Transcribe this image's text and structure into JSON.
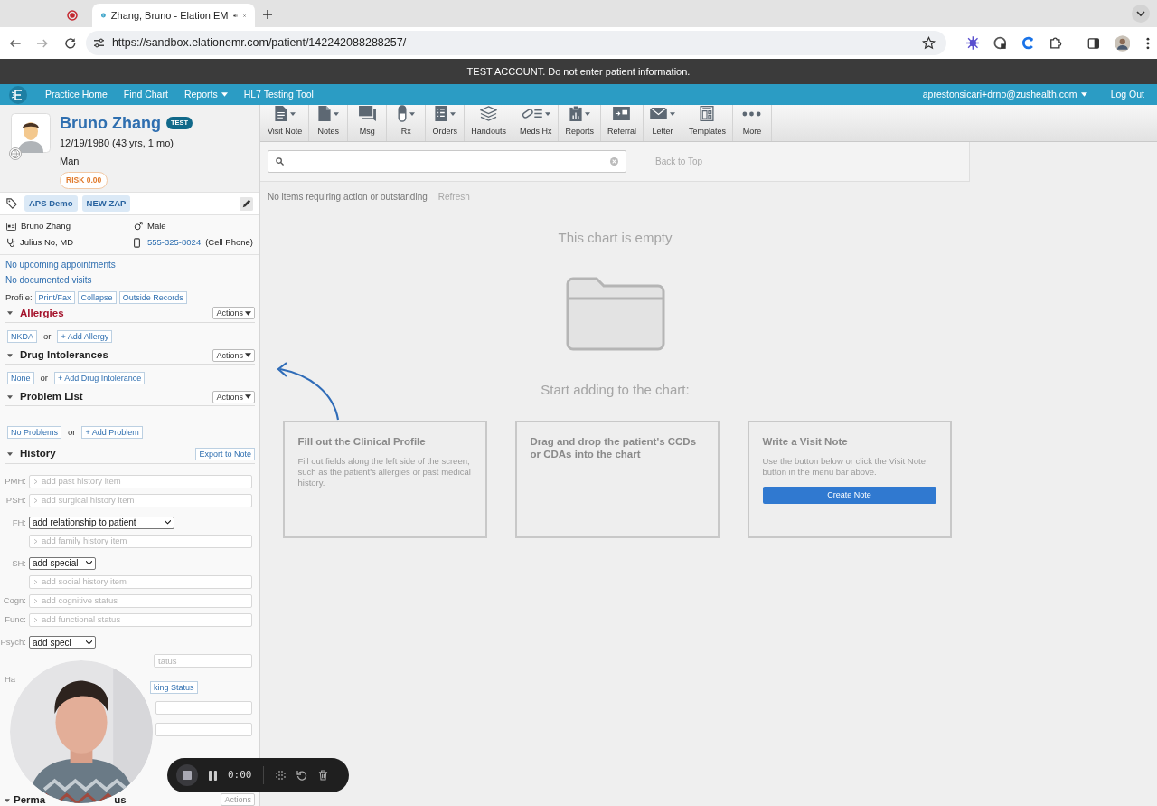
{
  "browser": {
    "tabs": [
      {
        "kind": "recording",
        "selected": false
      },
      {
        "kind": "page",
        "title": "Zhang, Bruno - Elation EM",
        "selected": true
      }
    ],
    "url": "https://sandbox.elationemr.com/patient/142242088288257/"
  },
  "banner": "TEST ACCOUNT. Do not enter patient information.",
  "nav": {
    "links": [
      {
        "label": "Practice Home",
        "dropdown": false
      },
      {
        "label": "Find Chart",
        "dropdown": false
      },
      {
        "label": "Reports",
        "dropdown": true
      },
      {
        "label": "HL7 Testing Tool",
        "dropdown": false
      }
    ],
    "user": "aprestonsicari+drno@zushealth.com",
    "logout": "Log Out"
  },
  "patient": {
    "name": "Bruno Zhang",
    "badge": "TEST",
    "dob": "12/19/1980 (43 yrs, 1 mo)",
    "gender": "Man",
    "risk": "RISK 0.00",
    "tags": [
      "APS Demo",
      "NEW ZAP"
    ],
    "details": [
      {
        "kind": "name",
        "text": "Bruno Zhang"
      },
      {
        "kind": "sex",
        "text": "Male"
      },
      {
        "kind": "provider",
        "text": "Julius No, MD"
      },
      {
        "kind": "phone",
        "link": "555-325-8024",
        "text": "(Cell Phone)"
      }
    ],
    "links": [
      "No upcoming appointments",
      "No documented visits"
    ],
    "profile": {
      "label": "Profile:",
      "buttons": [
        "Print/Fax",
        "Collapse",
        "Outside Records"
      ]
    }
  },
  "sections": [
    {
      "title": "Allergies",
      "alert": true,
      "action": "Actions",
      "options": [
        "NKDA",
        "+ Add Allergy"
      ],
      "joiner": "or"
    },
    {
      "title": "Drug Intolerances",
      "alert": false,
      "action": "Actions",
      "options": [
        "None",
        "+ Add Drug Intolerance"
      ],
      "joiner": "or"
    },
    {
      "title": "Problem List",
      "alert": false,
      "action": "Actions",
      "options": [
        "No Problems",
        "+ Add Problem"
      ],
      "joiner": "or"
    }
  ],
  "history": {
    "title": "History",
    "action": "Export to Note",
    "rows": [
      {
        "kind": "input",
        "label": "PMH:",
        "placeholder": "add past history item"
      },
      {
        "kind": "input",
        "label": "PSH:",
        "placeholder": "add surgical history item"
      },
      {
        "kind": "select",
        "label": "FH:",
        "value": "add relationship to patient"
      },
      {
        "kind": "input",
        "placeholder": "add family history item"
      },
      {
        "kind": "select",
        "label": "SH:",
        "value": "add special"
      },
      {
        "kind": "input",
        "placeholder": "add social history item"
      },
      {
        "kind": "input",
        "label": "Cogn:",
        "placeholder": "add cognitive status"
      },
      {
        "kind": "input",
        "label": "Func:",
        "placeholder": "add functional status"
      },
      {
        "kind": "select",
        "label": "Psych:",
        "value": "add speci"
      },
      {
        "kind": "partial",
        "placeholder": "tatus"
      },
      {
        "kind": "habit",
        "label": "Ha",
        "button": "king Status"
      },
      {
        "kind": "blank"
      },
      {
        "kind": "blank"
      }
    ]
  },
  "last_section": {
    "title_start": "Perma",
    "title_end": "us",
    "action": "Actions"
  },
  "toolbar": [
    {
      "label": "Visit Note",
      "dropdown": true
    },
    {
      "label": "Notes",
      "dropdown": true
    },
    {
      "label": "Msg",
      "dropdown": false
    },
    {
      "label": "Rx",
      "dropdown": true
    },
    {
      "label": "Orders",
      "dropdown": true
    },
    {
      "label": "Handouts",
      "dropdown": false
    },
    {
      "label": "Meds Hx",
      "dropdown": true
    },
    {
      "label": "Reports",
      "dropdown": true
    },
    {
      "label": "Referral",
      "dropdown": false
    },
    {
      "label": "Letter",
      "dropdown": true
    },
    {
      "label": "Templates",
      "dropdown": false
    },
    {
      "label": "More",
      "dropdown": false
    }
  ],
  "back_to_top": "Back to Top",
  "status": "No items requiring action or outstanding",
  "refresh": "Refresh",
  "empty_title": "This chart is empty",
  "start_text": "Start adding to the chart:",
  "cards": [
    {
      "title": "Fill out the Clinical Profile",
      "body": "Fill out fields along the left side of the screen, such as the patient's allergies or past medical history."
    },
    {
      "title": "Drag and drop the patient's CCDs or CDAs into the chart"
    },
    {
      "title": "Write a Visit Note",
      "body": "Use the button below or click the Visit Note button in the menu bar above.",
      "button": "Create Note"
    }
  ],
  "recorder": {
    "time": "0:00"
  }
}
